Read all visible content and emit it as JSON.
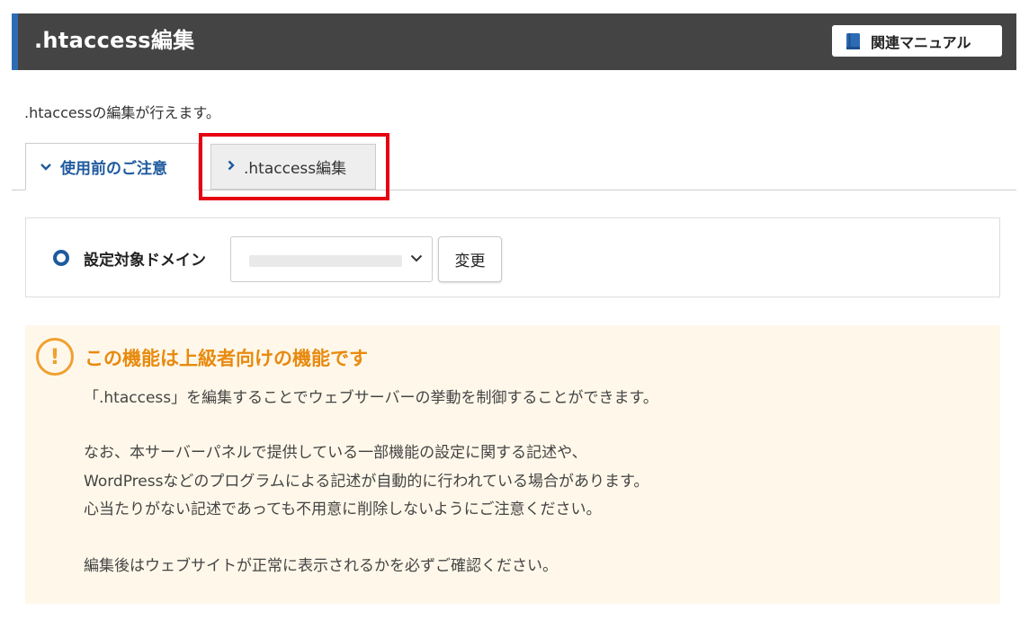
{
  "header": {
    "title": ".htaccess編集",
    "manual_label": "関連マニュアル",
    "manual_icon": "book-icon"
  },
  "description": ".htaccessの編集が行えます。",
  "tabs": [
    {
      "label": "使用前のご注意",
      "icon": "chevron-down-icon",
      "active": true
    },
    {
      "label": ".htaccess編集",
      "icon": "chevron-right-icon",
      "active": false
    }
  ],
  "domain": {
    "label": "設定対象ドメイン",
    "change_label": "変更"
  },
  "warning": {
    "icon_glyph": "!",
    "title": "この機能は上級者向けの機能です",
    "lines": [
      "「.htaccess」を編集することでウェブサーバーの挙動を制御することができます。",
      "なお、本サーバーパネルで提供している一部機能の設定に関する記述や、",
      "WordPressなどのプログラムによる記述が自動的に行われている場合があります。",
      "心当たりがない記述であっても不用意に削除しないようにご注意ください。",
      "編集後はウェブサイトが正常に表示されるかを必ずご確認ください。"
    ]
  },
  "colors": {
    "header_bg": "#444444",
    "accent_blue": "#2d6cb5",
    "link_blue": "#1e5a9e",
    "highlight_red": "#e60012",
    "warning_orange": "#e88a10",
    "warning_bg": "#fff8ea"
  }
}
